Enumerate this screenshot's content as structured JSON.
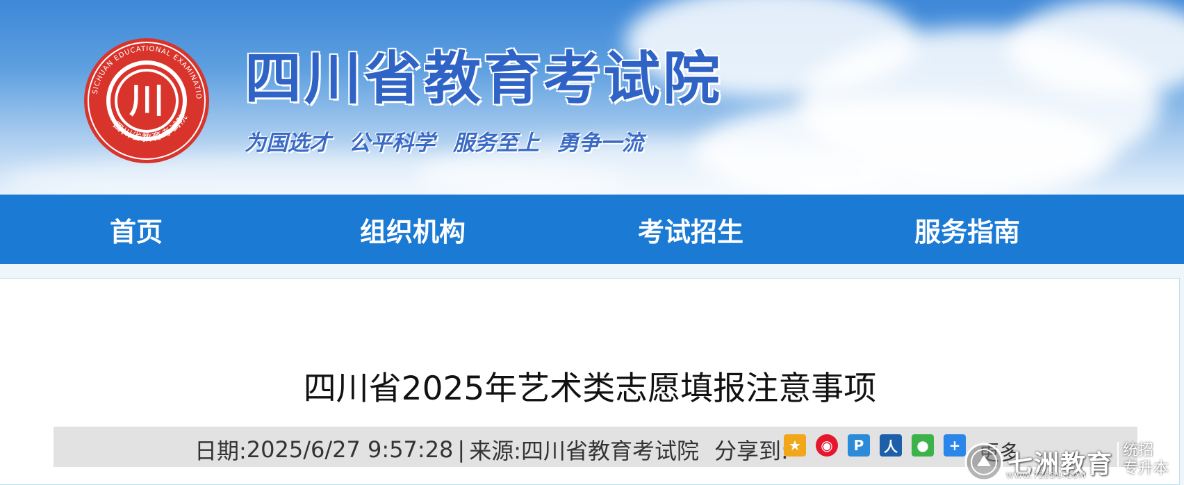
{
  "header": {
    "title": "四川省教育考试院",
    "slogans": [
      "为国选才",
      "公平科学",
      "服务至上",
      "勇争一流"
    ],
    "logo_ring_text": "SICHUAN EDUCATIONAL EXAMINATION AUTHORITY",
    "logo_bottom_text": "四川省教育考试院",
    "logo_center_glyph": "川"
  },
  "nav": {
    "items": [
      {
        "label": "首页"
      },
      {
        "label": "组织机构"
      },
      {
        "label": "考试招生"
      },
      {
        "label": "服务指南"
      }
    ]
  },
  "article": {
    "title": "四川省2025年艺术类志愿填报注意事项",
    "date_label": "日期:",
    "date_value": "2025/6/27 9:57:28",
    "separator": "|",
    "source_label": "来源:",
    "source_value": "四川省教育考试院",
    "share_label": "分享到:",
    "more_label": "更多"
  },
  "share_icons": [
    {
      "name": "qzone-icon",
      "color": "#f2a71a"
    },
    {
      "name": "weibo-icon",
      "color": "#e6162d"
    },
    {
      "name": "tencent-weibo-icon",
      "color": "#2c8bd8"
    },
    {
      "name": "renren-icon",
      "color": "#1e5faa"
    },
    {
      "name": "wechat-icon",
      "color": "#3bb34a"
    },
    {
      "name": "more-share-icon",
      "color": "#2a86e8"
    }
  ],
  "watermark": {
    "name": "七洲教育",
    "url": "WWW.7ZEDU.COM",
    "side_line1": "统招",
    "side_line2": "专升本"
  },
  "colors": {
    "nav_bg": "#1a7ad4",
    "title_blue": "#2f64c6",
    "logo_red": "#d9342b"
  }
}
